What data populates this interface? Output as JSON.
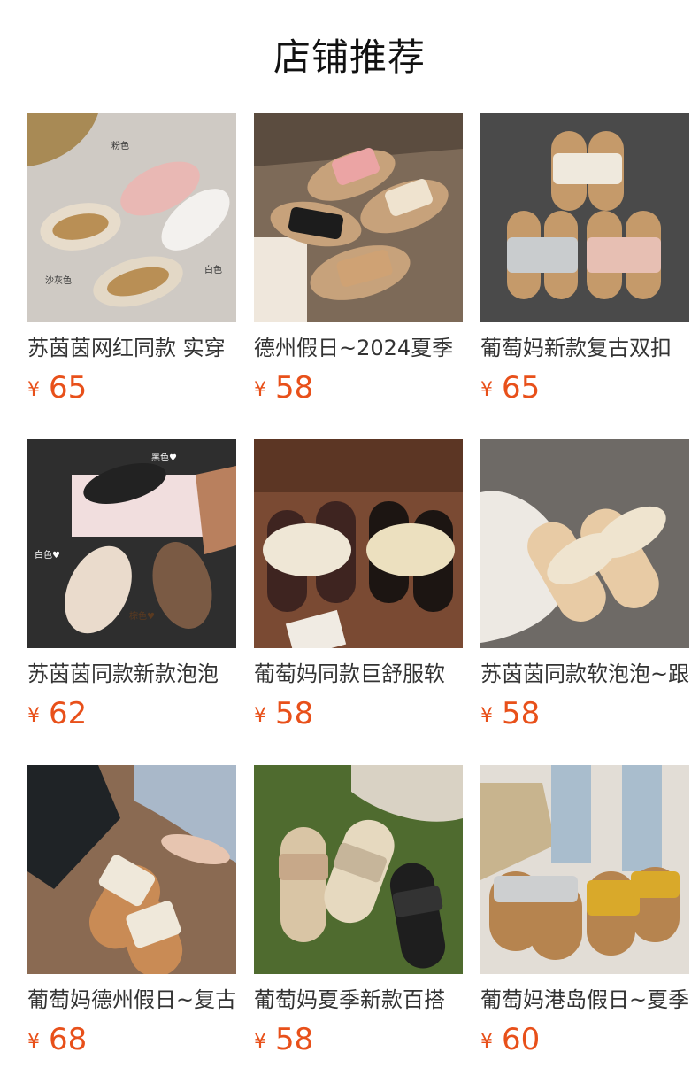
{
  "header": {
    "title": "店铺推荐"
  },
  "currency_symbol": "¥",
  "products": [
    {
      "name": "苏茵茵网红同款 实穿",
      "price": "65",
      "image_icon": "sandals-photo",
      "labels": [
        "粉色",
        "白色",
        "沙灰色"
      ]
    },
    {
      "name": "德州假日~2024夏季",
      "price": "58",
      "image_icon": "sandals-photo",
      "labels": []
    },
    {
      "name": "葡萄妈新款复古双扣",
      "price": "65",
      "image_icon": "sandals-photo",
      "labels": []
    },
    {
      "name": "苏茵茵同款新款泡泡",
      "price": "62",
      "image_icon": "sandals-photo",
      "labels": [
        "黑色♥",
        "白色♥",
        "棕色♥"
      ]
    },
    {
      "name": "葡萄妈同款巨舒服软",
      "price": "58",
      "image_icon": "sandals-photo",
      "labels": []
    },
    {
      "name": "苏茵茵同款软泡泡~跟",
      "price": "58",
      "image_icon": "sandals-photo",
      "labels": []
    },
    {
      "name": "葡萄妈德州假日~复古",
      "price": "68",
      "image_icon": "sandals-photo",
      "labels": []
    },
    {
      "name": "葡萄妈夏季新款百搭",
      "price": "58",
      "image_icon": "sandals-photo",
      "labels": []
    },
    {
      "name": "葡萄妈港岛假日~夏季",
      "price": "60",
      "image_icon": "sandals-photo",
      "labels": []
    }
  ]
}
